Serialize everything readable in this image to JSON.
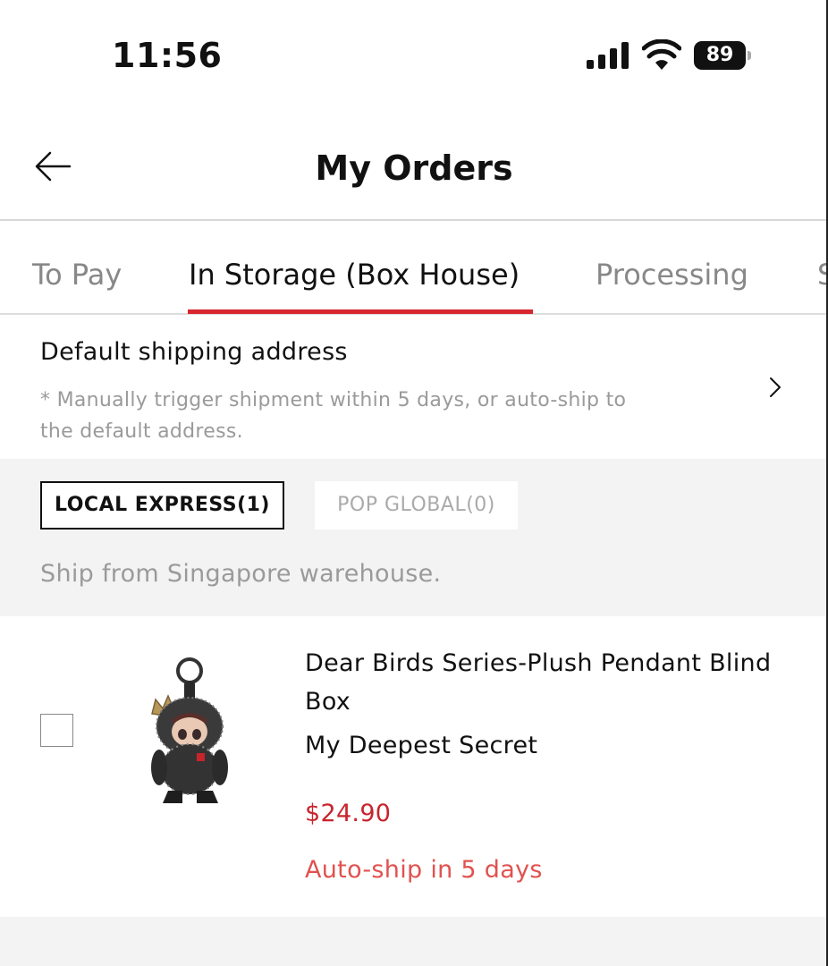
{
  "status_bar": {
    "time": "11:56",
    "battery": "89",
    "icons": [
      "signal-icon",
      "wifi-icon",
      "battery-icon"
    ]
  },
  "header": {
    "title": "My Orders",
    "back_icon": "back-arrow-icon"
  },
  "tabs": [
    {
      "label": "To Pay",
      "active": false
    },
    {
      "label": "In Storage (Box House)",
      "active": true
    },
    {
      "label": "Processing",
      "active": false
    },
    {
      "label": "S",
      "active": false
    }
  ],
  "address": {
    "title": "Default shipping address",
    "note": "* Manually trigger shipment within 5 days, or auto-ship to the default address."
  },
  "shipping_options": {
    "local": "LOCAL EXPRESS(1)",
    "global": "POP GLOBAL(0)",
    "ship_from": "Ship from Singapore warehouse."
  },
  "product": {
    "name": "Dear Birds Series-Plush Pendant Blind Box",
    "variant": "My Deepest Secret",
    "price": "$24.90",
    "autoship": "Auto-ship in 5 days",
    "checked": false
  },
  "colors": {
    "accent": "#d8262e",
    "price": "#c8242c",
    "autoship": "#e0524f"
  }
}
